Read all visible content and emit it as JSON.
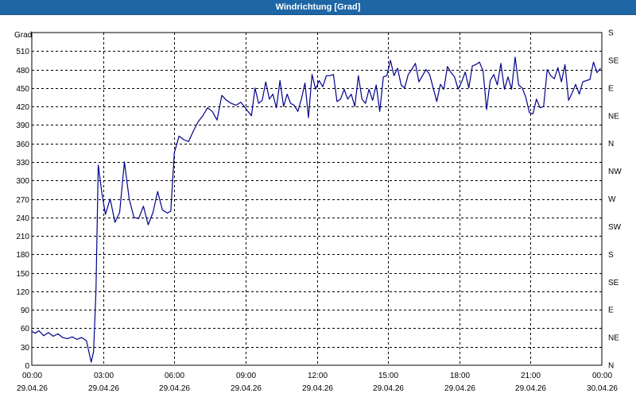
{
  "window": {
    "title": "Windrichtung [Grad]"
  },
  "chart_data": {
    "type": "line",
    "title": "Windrichtung [Grad]",
    "ylabel": "Grad",
    "xlabel": "",
    "ylim": [
      0,
      540
    ],
    "y_ticks": [
      0,
      30,
      60,
      90,
      120,
      150,
      180,
      210,
      240,
      270,
      300,
      330,
      360,
      390,
      420,
      450,
      480,
      510
    ],
    "right_axis_labels": [
      "N",
      "NE",
      "E",
      "SE",
      "S",
      "SW",
      "W",
      "NW",
      "N",
      "NE",
      "E",
      "SE",
      "S"
    ],
    "x_ticks": [
      {
        "time": "00:00",
        "date": "29.04.26"
      },
      {
        "time": "03:00",
        "date": "29.04.26"
      },
      {
        "time": "06:00",
        "date": "29.04.26"
      },
      {
        "time": "09:00",
        "date": "29.04.26"
      },
      {
        "time": "12:00",
        "date": "29.04.26"
      },
      {
        "time": "15:00",
        "date": "29.04.26"
      },
      {
        "time": "18:00",
        "date": "29.04.26"
      },
      {
        "time": "21:00",
        "date": "29.04.26"
      },
      {
        "time": "00:00",
        "date": "30.04.26"
      }
    ],
    "x_unit": "hours since 29.04.26 00:00",
    "grid": true,
    "line_color": "#00008b",
    "series": [
      {
        "name": "",
        "x": [
          0,
          0.15,
          0.3,
          0.5,
          0.7,
          0.9,
          1.1,
          1.3,
          1.5,
          1.7,
          1.9,
          2.1,
          2.3,
          2.5,
          2.6,
          2.7,
          2.8,
          2.95,
          3.1,
          3.3,
          3.5,
          3.7,
          3.9,
          4.1,
          4.3,
          4.5,
          4.7,
          4.9,
          5.1,
          5.3,
          5.5,
          5.7,
          5.85,
          6.0,
          6.2,
          6.4,
          6.6,
          6.8,
          7.0,
          7.2,
          7.4,
          7.6,
          7.8,
          8.0,
          8.2,
          8.4,
          8.6,
          8.8,
          8.95,
          9.1,
          9.25,
          9.4,
          9.55,
          9.7,
          9.85,
          10.0,
          10.15,
          10.3,
          10.45,
          10.6,
          10.75,
          10.9,
          11.05,
          11.2,
          11.35,
          11.5,
          11.65,
          11.8,
          11.95,
          12.1,
          12.25,
          12.4,
          12.55,
          12.7,
          12.85,
          13.0,
          13.15,
          13.3,
          13.45,
          13.6,
          13.75,
          13.9,
          14.05,
          14.2,
          14.35,
          14.5,
          14.65,
          14.8,
          14.95,
          15.1,
          15.25,
          15.4,
          15.55,
          15.7,
          15.85,
          16.0,
          16.15,
          16.3,
          16.45,
          16.6,
          16.75,
          16.9,
          17.05,
          17.2,
          17.35,
          17.5,
          17.65,
          17.8,
          17.95,
          18.1,
          18.25,
          18.4,
          18.55,
          18.7,
          18.85,
          19.0,
          19.15,
          19.3,
          19.45,
          19.6,
          19.75,
          19.9,
          20.05,
          20.2,
          20.35,
          20.5,
          20.65,
          20.8,
          20.95,
          21.1,
          21.25,
          21.4,
          21.55,
          21.7,
          21.85,
          22.0,
          22.15,
          22.3,
          22.45,
          22.6,
          22.75,
          22.9,
          23.05,
          23.2,
          23.35,
          23.5,
          23.65,
          23.8,
          23.95
        ],
        "y": [
          55,
          52,
          56,
          48,
          53,
          47,
          51,
          45,
          43,
          46,
          42,
          45,
          40,
          5,
          22,
          120,
          325,
          280,
          245,
          270,
          232,
          248,
          330,
          270,
          240,
          238,
          258,
          228,
          248,
          282,
          252,
          247,
          250,
          345,
          372,
          366,
          363,
          380,
          395,
          405,
          418,
          412,
          398,
          438,
          430,
          425,
          422,
          427,
          420,
          412,
          405,
          450,
          425,
          430,
          460,
          432,
          440,
          418,
          462,
          420,
          440,
          425,
          422,
          412,
          432,
          458,
          402,
          472,
          448,
          462,
          452,
          470,
          470,
          472,
          428,
          432,
          448,
          432,
          440,
          420,
          470,
          432,
          425,
          448,
          430,
          455,
          412,
          468,
          470,
          495,
          470,
          482,
          455,
          450,
          472,
          480,
          490,
          460,
          470,
          480,
          472,
          450,
          428,
          456,
          448,
          485,
          475,
          468,
          448,
          460,
          476,
          450,
          486,
          488,
          492,
          478,
          415,
          462,
          472,
          455,
          490,
          448,
          468,
          448,
          500,
          455,
          450,
          435,
          410,
          408,
          432,
          418,
          420,
          480,
          470,
          465,
          483,
          460,
          488,
          430,
          442,
          456,
          440,
          460,
          462,
          464,
          492,
          475,
          482
        ]
      }
    ]
  }
}
